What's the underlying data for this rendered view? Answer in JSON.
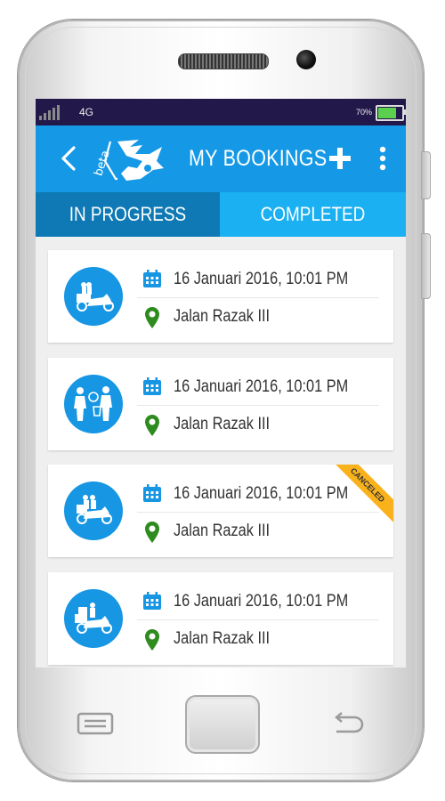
{
  "statusbar": {
    "network": "4G",
    "battery_percent": "70%",
    "battery_level": 0.7,
    "icons": [
      "signal-icon",
      "battery-icon"
    ]
  },
  "appbar": {
    "logo_text": "beta",
    "title": "MY BOOKINGS",
    "icons": [
      "back-arrow-icon",
      "plus-icon",
      "more-vert-icon"
    ]
  },
  "tabs": [
    {
      "label": "IN PROGRESS"
    },
    {
      "label": "COMPLETED"
    }
  ],
  "bookings": [
    {
      "date": "16 Januari 2016, 10:01 PM",
      "location": "Jalan Razak III",
      "service_icon": "motorbike-passenger-icon"
    },
    {
      "date": "16 Januari 2016, 10:01 PM",
      "location": "Jalan Razak III",
      "service_icon": "shopping-delivery-icon"
    },
    {
      "date": "16 Januari 2016, 10:01 PM",
      "location": "Jalan Razak III",
      "service_icon": "motorbike-courier-icon",
      "badge": "CANCELED"
    },
    {
      "date": "16 Januari 2016, 10:01 PM",
      "location": "Jalan Razak III",
      "service_icon": "motorbike-cargo-icon"
    }
  ],
  "colors": {
    "appbar": "#1599e6",
    "tab_inactive": "#0e79b4",
    "tab_active": "#1ab0f2",
    "badge": "#f9b21b",
    "location_pin": "#2e8b1e",
    "calendar": "#1696e3"
  }
}
